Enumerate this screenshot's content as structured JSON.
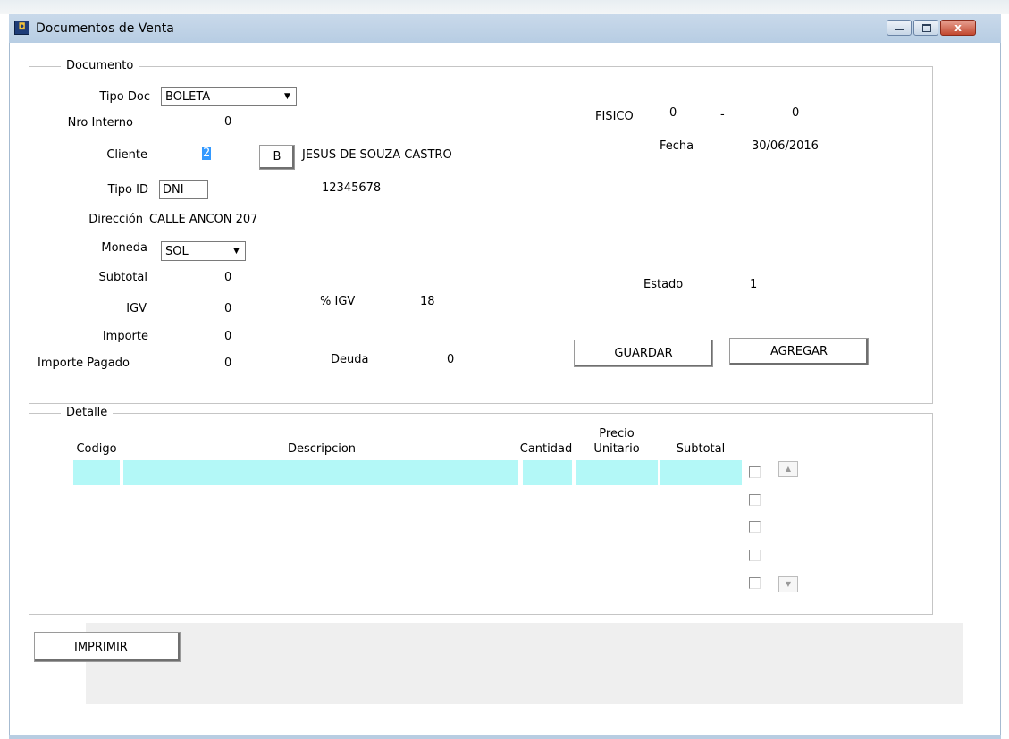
{
  "window": {
    "title": "Documentos de Venta",
    "close_glyph": "x"
  },
  "documento": {
    "legend": "Documento",
    "tipo_doc_label": "Tipo Doc",
    "tipo_doc_value": "BOLETA",
    "nro_interno_label": "Nro Interno",
    "nro_interno_value": "0",
    "cliente_label": "Cliente",
    "cliente_code": "2",
    "buscar_button": "B",
    "cliente_name": "JESUS DE SOUZA CASTRO",
    "tipo_id_label": "Tipo ID",
    "tipo_id_value": "DNI",
    "id_number": "12345678",
    "direccion_label": "Dirección",
    "direccion_value": "CALLE ANCON 207",
    "moneda_label": "Moneda",
    "moneda_value": "SOL",
    "subtotal_label": "Subtotal",
    "subtotal_value": "0",
    "igv_label": "IGV",
    "igv_value": "0",
    "igv_pct_label": "% IGV",
    "igv_pct_value": "18",
    "importe_label": "Importe",
    "importe_value": "0",
    "importe_pagado_label": "Importe Pagado",
    "importe_pagado_value": "0",
    "deuda_label": "Deuda",
    "deuda_value": "0",
    "fisico_label": "FISICO",
    "fisico_serie": "0",
    "fisico_sep": "-",
    "fisico_numero": "0",
    "fecha_label": "Fecha",
    "fecha_value": "30/06/2016",
    "estado_label": "Estado",
    "estado_value": "1",
    "guardar_button": "GUARDAR",
    "agregar_button": "AGREGAR"
  },
  "detalle": {
    "legend": "Detalle",
    "columns": {
      "codigo": "Codigo",
      "descripcion": "Descripcion",
      "cantidad": "Cantidad",
      "precio_line1": "Precio",
      "precio_line2": "Unitario",
      "subtotal": "Subtotal"
    },
    "scroll_up": "▲",
    "scroll_down": "▼"
  },
  "footer": {
    "imprimir_button": "IMPRIMIR"
  },
  "icons": {
    "select_arrow": "▼"
  }
}
